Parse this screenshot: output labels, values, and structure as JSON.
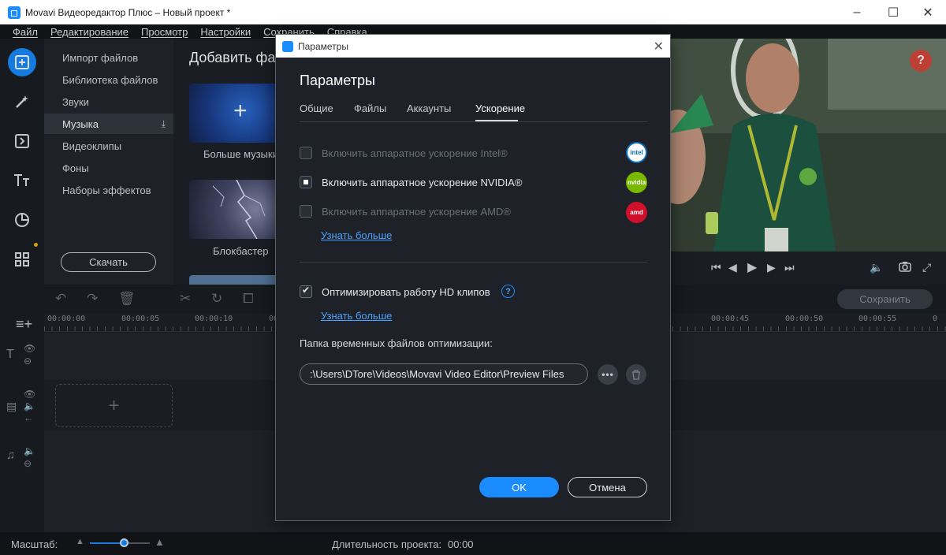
{
  "window": {
    "title": "Movavi Видеоредактор Плюс – Новый проект *"
  },
  "menu": [
    "Файл",
    "Редактирование",
    "Просмотр",
    "Настройки",
    "Сохранить",
    "Справка"
  ],
  "sidebar": {
    "items": [
      {
        "label": "Импорт файлов"
      },
      {
        "label": "Библиотека файлов"
      },
      {
        "label": "Звуки"
      },
      {
        "label": "Музыка"
      },
      {
        "label": "Видеоклипы"
      },
      {
        "label": "Фоны"
      },
      {
        "label": "Наборы эффектов"
      }
    ],
    "active_index": 3,
    "download_label": "Скачать"
  },
  "content": {
    "heading": "Добавить фа",
    "tiles": [
      {
        "label": "Больше музыки"
      },
      {
        "label": "Блокбастер"
      }
    ]
  },
  "timeline": {
    "save_label": "Сохранить",
    "ticks": [
      "00:00:00",
      "00:00:05",
      "00:00:10",
      "00",
      "00:00:45",
      "00:00:50",
      "00:00:55",
      "0"
    ]
  },
  "status": {
    "scale_label": "Масштаб:",
    "zoom_level": 0.58,
    "duration_label": "Длительность проекта:",
    "duration_value": "00:00"
  },
  "dialog": {
    "window_title": "Параметры",
    "heading": "Параметры",
    "tabs": [
      "Общие",
      "Файлы",
      "Аккаунты",
      "Ускорение"
    ],
    "active_tab": 3,
    "options": {
      "intel": {
        "label": "Включить аппаратное ускорение Intel®",
        "enabled": false,
        "checked": false,
        "badge": "intel"
      },
      "nvidia": {
        "label": "Включить аппаратное ускорение NVIDIA®",
        "enabled": true,
        "checked": true,
        "badge": "nvidia"
      },
      "amd": {
        "label": "Включить аппаратное ускорение AMD®",
        "enabled": false,
        "checked": false,
        "badge": "amd"
      }
    },
    "learn_more_1": "Узнать больше",
    "optimize": {
      "label": "Оптимизировать работу HD клипов",
      "checked": true
    },
    "help_glyph": "?",
    "learn_more_2": "Узнать больше",
    "temp_folder_label": "Папка временных файлов оптимизации:",
    "temp_folder_path": ":\\Users\\DTore\\Videos\\Movavi Video Editor\\Preview Files",
    "ok_label": "OK",
    "cancel_label": "Отмена"
  },
  "colors": {
    "accent": "#1a8cff",
    "intel_badge": "#0a6fb8",
    "nvidia_badge": "#76b900",
    "amd_badge": "#d0102a"
  }
}
